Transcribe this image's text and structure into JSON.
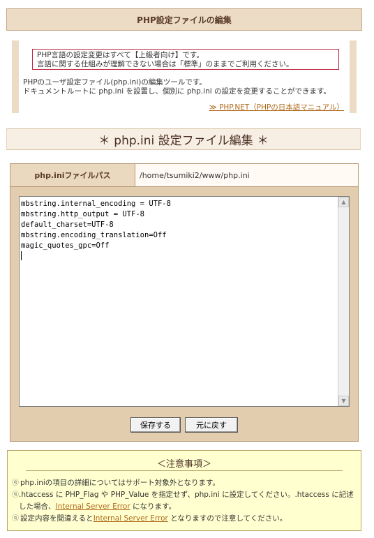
{
  "page_title": "PHP設定ファイルの編集",
  "warning": {
    "line1": "PHP言語の設定変更はすべて【上級者向け】です。",
    "line2": "言語に関する仕組みが理解できない場合は「標準」のままでご利用ください。"
  },
  "description": {
    "line1": "PHPのユーザ設定ファイル(php.ini)の編集ツールです。",
    "line2": "ドキュメントルートに php.ini を設置し、個別に php.ini の設定を変更することができます。"
  },
  "external_link": "≫ PHP.NET（PHPの日本語マニュアル）",
  "section_title": "＊ php.ini 設定ファイル編集 ＊",
  "path_row": {
    "label": "php.iniファイルパス",
    "value": "/home/tsumiki2/www/php.ini"
  },
  "editor_content": "mbstring.internal_encoding = UTF-8\nmbstring.http_output = UTF-8\ndefault_charset=UTF-8\nmbstring.encoding_translation=Off\nmagic_quotes_gpc=Off",
  "buttons": {
    "save": "保存する",
    "reset": "元に戻す"
  },
  "notice": {
    "title": "＜注意事項＞",
    "item1": "php.iniの項目の詳細についてはサポート対象外となります。",
    "item2_a": ".htaccess に PHP_Flag や PHP_Value を指定せず、php.ini に設定してください。.htaccess に記述した場合、",
    "item2_link": "Internal Server Error",
    "item2_b": " になります。",
    "item3_a": "設定内容を間違えると",
    "item3_link": "Internal Server Error",
    "item3_b": " となりますので注意してください。"
  }
}
